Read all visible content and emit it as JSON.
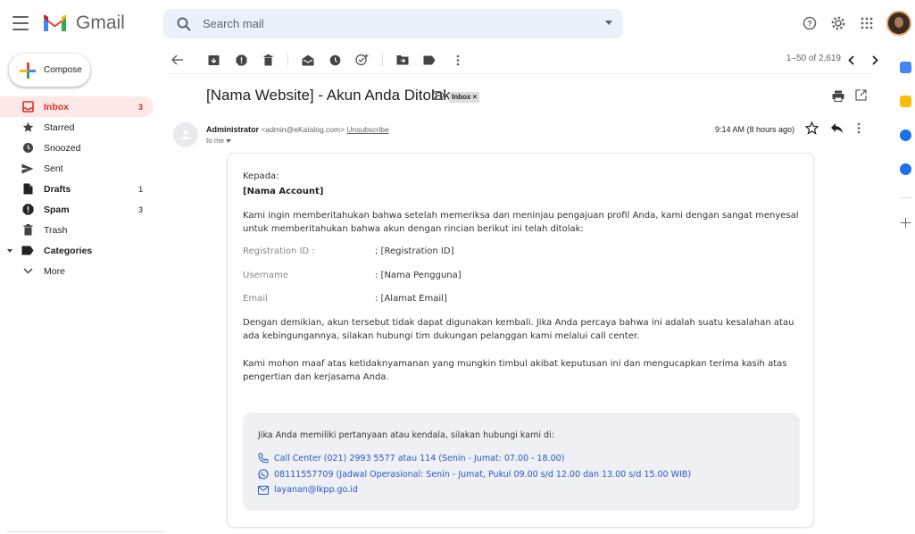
{
  "app": {
    "name": "Gmail"
  },
  "search": {
    "placeholder": "Search mail"
  },
  "compose": {
    "label": "Compose"
  },
  "nav": [
    {
      "label": "Inbox",
      "count": "3",
      "icon": "inbox-icon"
    },
    {
      "label": "Starred",
      "count": "",
      "icon": "star-icon"
    },
    {
      "label": "Snoozed",
      "count": "",
      "icon": "clock-icon"
    },
    {
      "label": "Sent",
      "count": "",
      "icon": "send-icon"
    },
    {
      "label": "Drafts",
      "count": "1",
      "icon": "draft-icon"
    },
    {
      "label": "Spam",
      "count": "3",
      "icon": "spam-icon"
    },
    {
      "label": "Trash",
      "count": "",
      "icon": "trash-icon"
    },
    {
      "label": "Categories",
      "count": "",
      "icon": "label-icon"
    },
    {
      "label": "More",
      "count": "",
      "icon": "chevron-down-icon"
    }
  ],
  "pager": {
    "range": "1–50 of 2,619"
  },
  "email": {
    "subject": "[Nama Website] - Akun Anda Ditolak",
    "label_chip": "Inbox ×",
    "sender_name": "Administrator",
    "sender_email": "<admin@eKatalog.com>",
    "unsubscribe": "Unsubscribe",
    "to": "to me",
    "time": "9:14 AM (8 hours ago)"
  },
  "body": {
    "greeting": "Kepada:",
    "account": "[Nama Account]",
    "intro": "Kami ingin memberitahukan bahwa setelah memeriksa dan meninjau pengajuan profil Anda, kami dengan sangat menyesal untuk memberitahukan bahwa akun dengan rincian berikut ini telah ditolak:",
    "fields": [
      {
        "label": "Registration ID :",
        "value": ";  [Registration ID]"
      },
      {
        "label": "Username",
        "value": ":  [Nama Pengguna]"
      },
      {
        "label": "Email",
        "value": ":  [Alamat Email]"
      }
    ],
    "para2": "Dengan demikian, akun tersebut tidak dapat digunakan kembali. Jika Anda percaya bahwa ini adalah suatu kesalahan atau ada kebingungannya, silakan hubungi tim dukungan pelanggan kami melalui call center.",
    "para3": "Kami mohon maaf atas ketidaknyamanan yang mungkin timbul akibat keputusan ini dan mengucapkan terima kasih atas pengertian dan kerjasama Anda.",
    "contact_intro": "Jika Anda memiliki pertanyaan atau kendala, silakan hubungi kami di:",
    "call_center": "Call Center (021) 2993 5577 atau 114 (Senin - Jumat: 07.00 - 18.00)",
    "whatsapp": "08111557709 (Jadwal Operasional: Senin - Jumat, Pukul 09.00 s/d 12.00 dan  13.00 s/d 15.00 WIB)",
    "email": "layanan@lkpp.go.id"
  },
  "colors": {
    "accent": "#d93025",
    "link": "#2a56c6",
    "search_bg": "#eaf1fb"
  }
}
